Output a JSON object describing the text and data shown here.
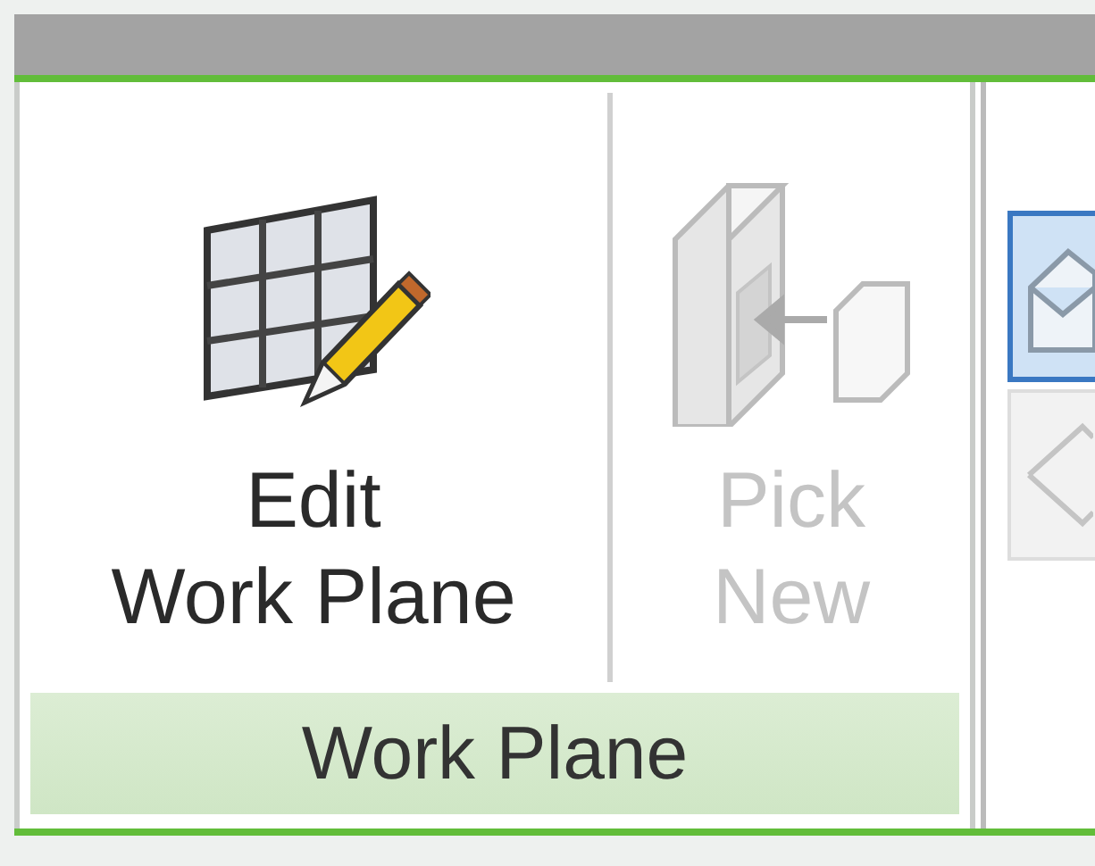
{
  "panels": [
    {
      "label": "Work Plane",
      "buttons": [
        {
          "kind": "edit",
          "lines": [
            "Edit",
            "Work Plane"
          ],
          "disabled": false
        },
        {
          "kind": "pick",
          "lines": [
            "Pick",
            "New"
          ],
          "disabled": true
        }
      ]
    }
  ],
  "side_buttons": [
    {
      "kind": "box",
      "selected": true
    },
    {
      "kind": "plane",
      "selected": false
    }
  ]
}
